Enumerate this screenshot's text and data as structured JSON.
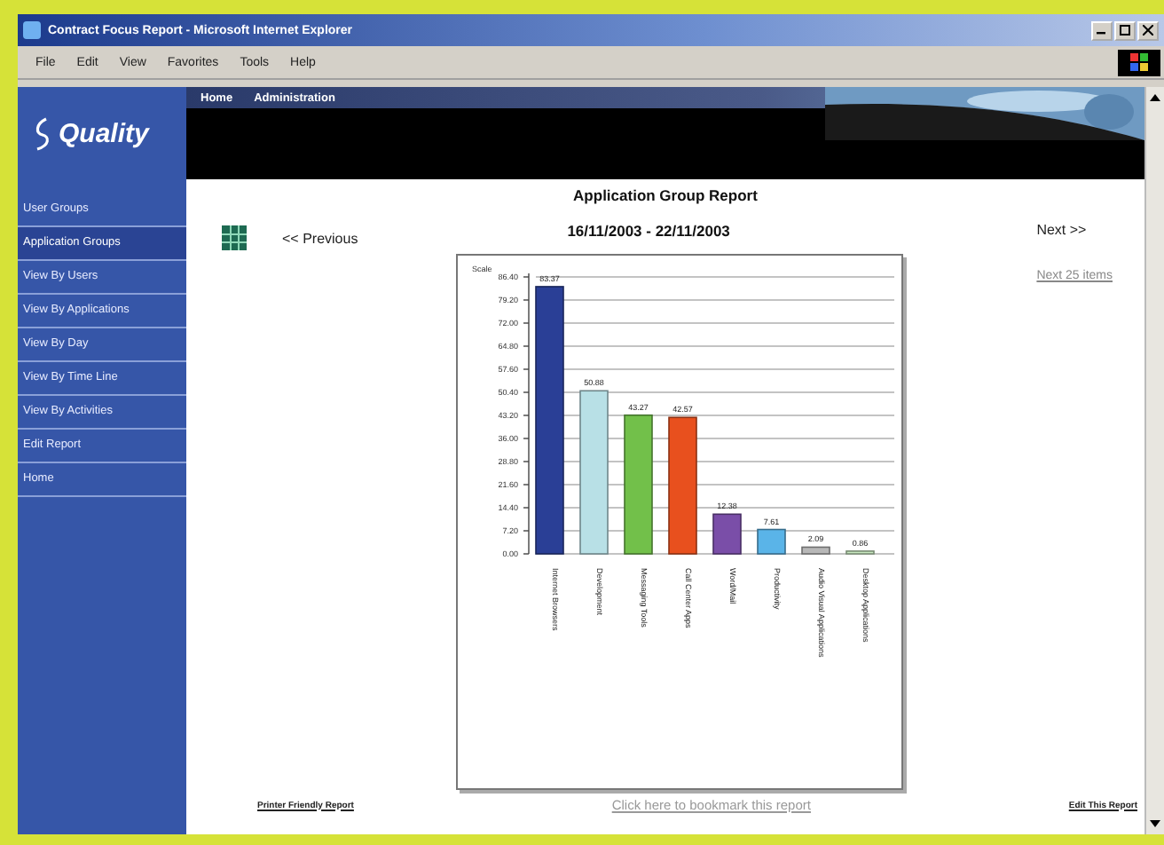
{
  "window": {
    "title": "Contract Focus Report - Microsoft Internet Explorer"
  },
  "menu": [
    "File",
    "Edit",
    "View",
    "Favorites",
    "Tools",
    "Help"
  ],
  "header": {
    "logo": "Quality",
    "nav": [
      "Home",
      "Administration"
    ]
  },
  "sidebar": {
    "items": [
      {
        "label": "User Groups",
        "selected": false
      },
      {
        "label": "Application Groups",
        "selected": true
      },
      {
        "label": "View By Users",
        "selected": false
      },
      {
        "label": "View By Applications",
        "selected": false
      },
      {
        "label": "View By Day",
        "selected": false
      },
      {
        "label": "View By Time Line",
        "selected": false
      },
      {
        "label": "View By Activities",
        "selected": false
      },
      {
        "label": "Edit Report",
        "selected": false
      },
      {
        "label": "Home",
        "selected": false
      }
    ]
  },
  "report": {
    "title": "Application Group Report",
    "previous": "<< Previous",
    "date_range": "16/11/2003 - 22/11/2003",
    "next": "Next >>",
    "next_items": "Next 25 items",
    "chart_data": {
      "type": "bar",
      "ylabel": "Scale",
      "categories": [
        "Internet Browsers",
        "Development",
        "Messaging Tools",
        "Call Center Apps",
        "Word/Mail",
        "Productivity",
        "Audio Visual Applications",
        "Desktop Applications"
      ],
      "series": [
        {
          "values": [
            83.37,
            50.88,
            43.27,
            42.57,
            12.38,
            7.61,
            2.09,
            0.86
          ]
        }
      ],
      "colors": [
        "#2a3f96",
        "#b8e0e6",
        "#72c04a",
        "#e8501e",
        "#7a4ea8",
        "#5ab4e8",
        "#b8b8b8",
        "#c8e8c0"
      ],
      "ylim": [
        0,
        86.4
      ],
      "yticks": [
        {
          "value": 0,
          "label": "0.00"
        },
        {
          "value": 7.2,
          "label": "7.20"
        },
        {
          "value": 14.4,
          "label": "14.40"
        },
        {
          "value": 21.6,
          "label": "21.60"
        },
        {
          "value": 28.8,
          "label": "28.80"
        },
        {
          "value": 36,
          "label": "36.00"
        },
        {
          "value": 43.2,
          "label": "43.20"
        },
        {
          "value": 50.4,
          "label": "50.40"
        },
        {
          "value": 57.6,
          "label": "57.60"
        },
        {
          "value": 64.8,
          "label": "64.80"
        },
        {
          "value": 72,
          "label": "72.00"
        },
        {
          "value": 79.2,
          "label": "79.20"
        },
        {
          "value": 86.4,
          "label": "86.40"
        }
      ],
      "data_labels": true,
      "grid": true
    },
    "footer": {
      "left": "Printer Friendly Report",
      "center": "Click here to bookmark this report",
      "right": "Edit This Report"
    }
  }
}
